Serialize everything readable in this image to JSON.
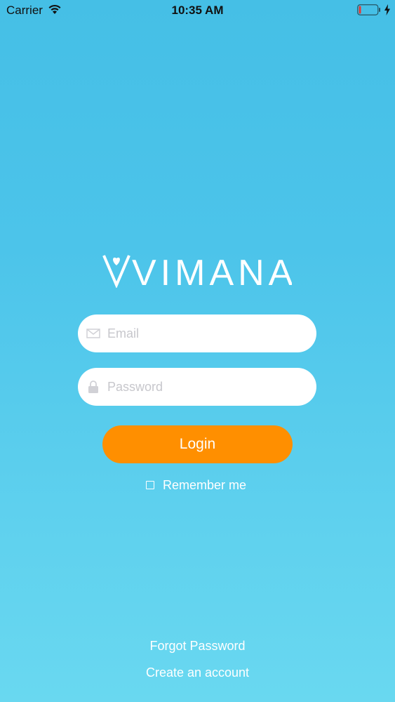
{
  "status_bar": {
    "carrier": "Carrier",
    "time": "10:35 AM",
    "wifi_icon": "wifi-icon",
    "battery_icon": "battery-low-icon",
    "charging_icon": "charging-bolt-icon",
    "battery_level": 0.1
  },
  "logo": {
    "text": "VIMANA"
  },
  "form": {
    "email": {
      "placeholder": "Email",
      "value": "",
      "icon": "envelope-icon"
    },
    "password": {
      "placeholder": "Password",
      "value": "",
      "icon": "lock-icon"
    },
    "login_label": "Login",
    "remember_label": "Remember me",
    "remember_checked": false
  },
  "links": {
    "forgot_password": "Forgot Password",
    "create_account": "Create an account"
  },
  "colors": {
    "background_top": "#45BFE6",
    "background_bottom": "#69D8F0",
    "login_button": "#FF8F00",
    "field_bg": "#FFFFFF",
    "placeholder": "#C7C7CC"
  }
}
